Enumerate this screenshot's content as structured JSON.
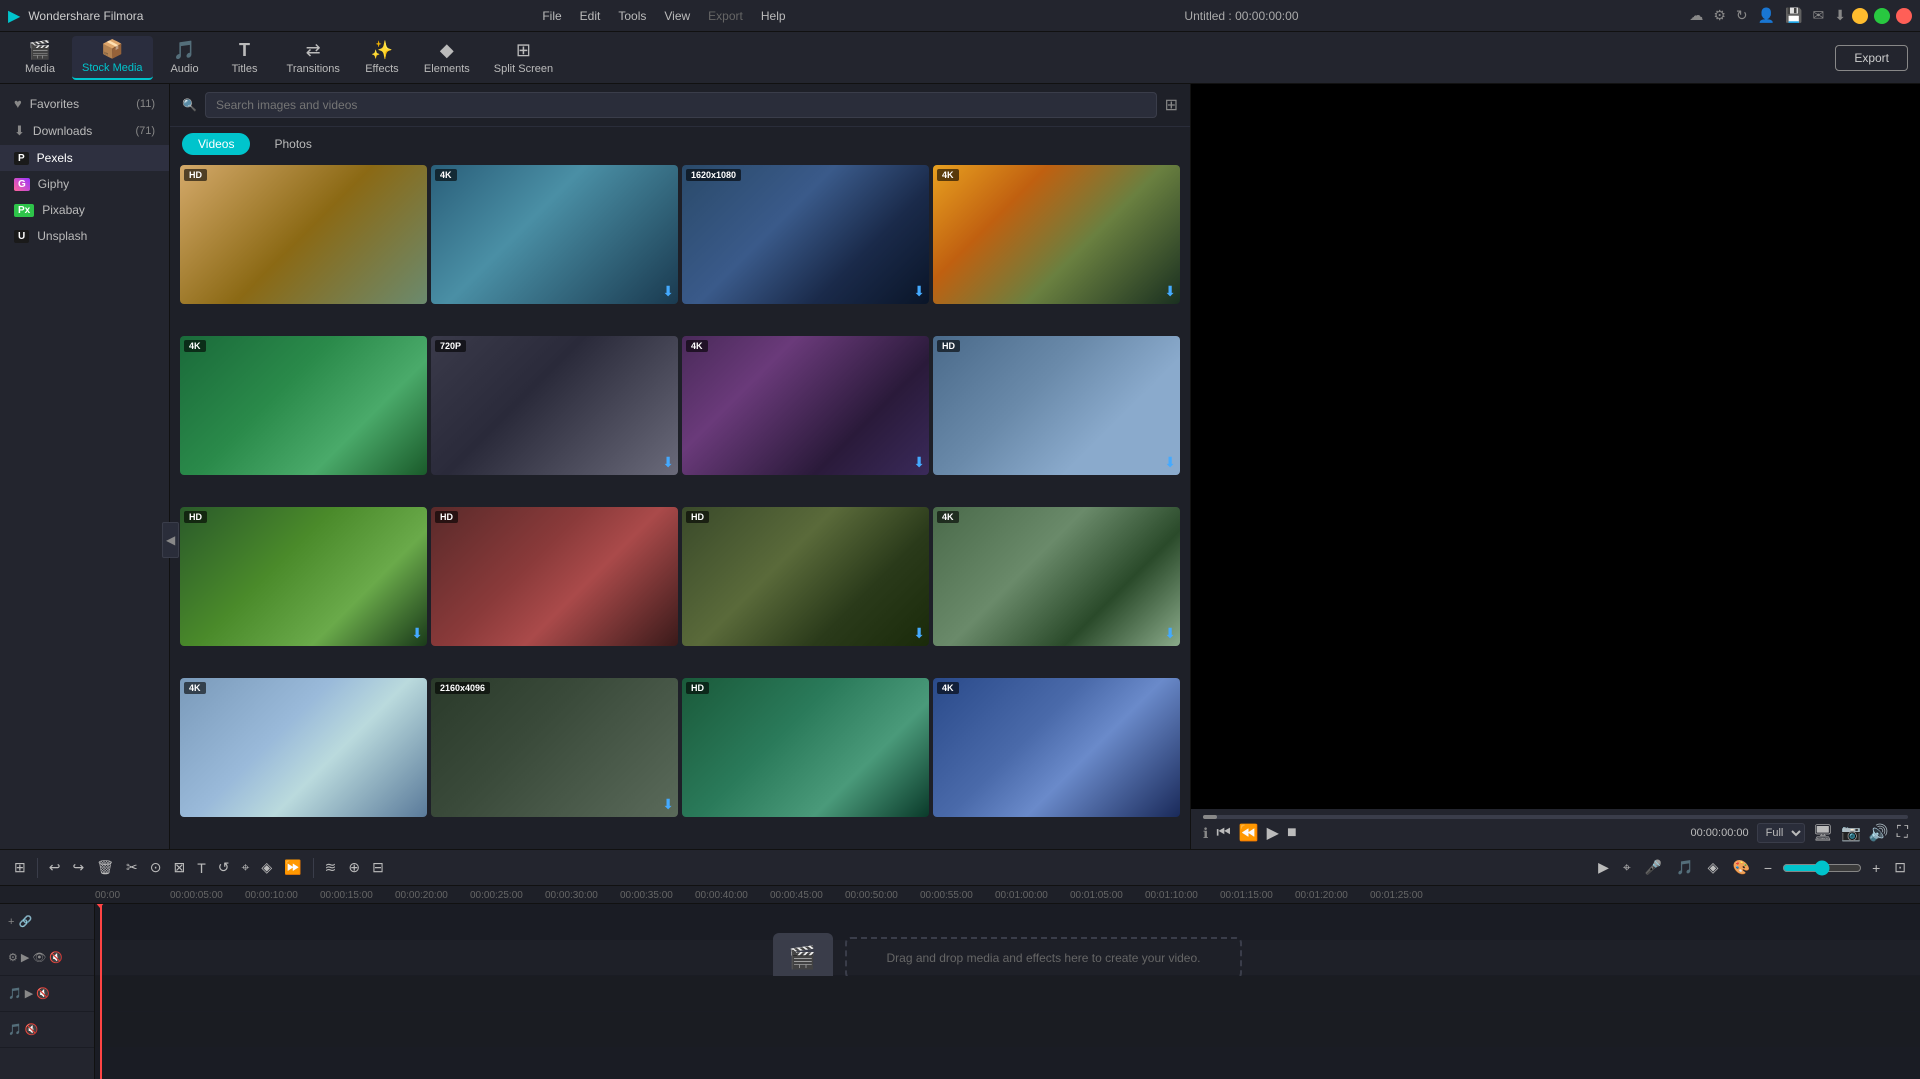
{
  "app": {
    "name": "Wondershare Filmora",
    "title": "Untitled : 00:00:00:00"
  },
  "menu": {
    "items": [
      "File",
      "Edit",
      "Tools",
      "View",
      "Export",
      "Help"
    ]
  },
  "toolbar": {
    "buttons": [
      {
        "id": "media",
        "label": "Media",
        "icon": "🎬"
      },
      {
        "id": "stock-media",
        "label": "Stock Media",
        "icon": "📦"
      },
      {
        "id": "audio",
        "label": "Audio",
        "icon": "🎵"
      },
      {
        "id": "titles",
        "label": "Titles",
        "icon": "T"
      },
      {
        "id": "transitions",
        "label": "Transitions",
        "icon": "⇄"
      },
      {
        "id": "effects",
        "label": "Effects",
        "icon": "✨"
      },
      {
        "id": "elements",
        "label": "Elements",
        "icon": "◆"
      },
      {
        "id": "split-screen",
        "label": "Split Screen",
        "icon": "⊞"
      }
    ],
    "export_label": "Export"
  },
  "sidebar": {
    "items": [
      {
        "id": "favorites",
        "label": "Favorites",
        "count": "(11)",
        "icon": "♥"
      },
      {
        "id": "downloads",
        "label": "Downloads",
        "count": "(71)",
        "icon": "⬇"
      },
      {
        "id": "pexels",
        "label": "Pexels",
        "count": "",
        "icon": "P"
      },
      {
        "id": "giphy",
        "label": "Giphy",
        "count": "",
        "icon": "G"
      },
      {
        "id": "pixabay",
        "label": "Pixabay",
        "count": "",
        "icon": "Px"
      },
      {
        "id": "unsplash",
        "label": "Unsplash",
        "count": "",
        "icon": "U"
      }
    ]
  },
  "search": {
    "placeholder": "Search images and videos"
  },
  "tabs": {
    "items": [
      {
        "id": "videos",
        "label": "Videos",
        "active": true
      },
      {
        "id": "photos",
        "label": "Photos",
        "active": false
      }
    ]
  },
  "videos": [
    {
      "id": 1,
      "badge": "HD",
      "cls": "t1",
      "has_dl": false
    },
    {
      "id": 2,
      "badge": "4K",
      "cls": "t2",
      "has_dl": true
    },
    {
      "id": 3,
      "badge": "1620x1080",
      "cls": "t3",
      "has_dl": true
    },
    {
      "id": 4,
      "badge": "4K",
      "cls": "t4",
      "has_dl": true
    },
    {
      "id": 5,
      "badge": "4K",
      "cls": "t5",
      "has_dl": false
    },
    {
      "id": 6,
      "badge": "720P",
      "cls": "t6",
      "has_dl": true
    },
    {
      "id": 7,
      "badge": "4K",
      "cls": "t7",
      "has_dl": true
    },
    {
      "id": 8,
      "badge": "HD",
      "cls": "t8",
      "has_dl": true
    },
    {
      "id": 9,
      "badge": "HD",
      "cls": "t9",
      "has_dl": false
    },
    {
      "id": 10,
      "badge": "HD",
      "cls": "t10",
      "has_dl": false
    },
    {
      "id": 11,
      "badge": "HD",
      "cls": "t11",
      "has_dl": true
    },
    {
      "id": 12,
      "badge": "4K",
      "cls": "t12",
      "has_dl": true
    },
    {
      "id": 13,
      "badge": "4K",
      "cls": "t13",
      "has_dl": false
    },
    {
      "id": 14,
      "badge": "2160x4096",
      "cls": "t14",
      "has_dl": true
    },
    {
      "id": 15,
      "badge": "HD",
      "cls": "t15",
      "has_dl": false
    },
    {
      "id": 16,
      "badge": "4K",
      "cls": "t16",
      "has_dl": false
    }
  ],
  "preview": {
    "time_current": "00:00:00:00",
    "quality": "Full"
  },
  "timeline": {
    "markers": [
      "00:00",
      "00:00:05:00",
      "00:00:10:00",
      "00:00:15:00",
      "00:00:20:00",
      "00:00:25:00",
      "00:00:30:00",
      "00:00:35:00",
      "00:00:40:00",
      "00:00:45:00",
      "00:00:50:00",
      "00:00:55:00",
      "00:01:00:00",
      "00:01:05:00",
      "00:01:10:00",
      "00:01:15:00",
      "00:01:20:00",
      "00:01:25:00"
    ],
    "drop_hint": "Drag and drop media and effects here to create your video."
  }
}
